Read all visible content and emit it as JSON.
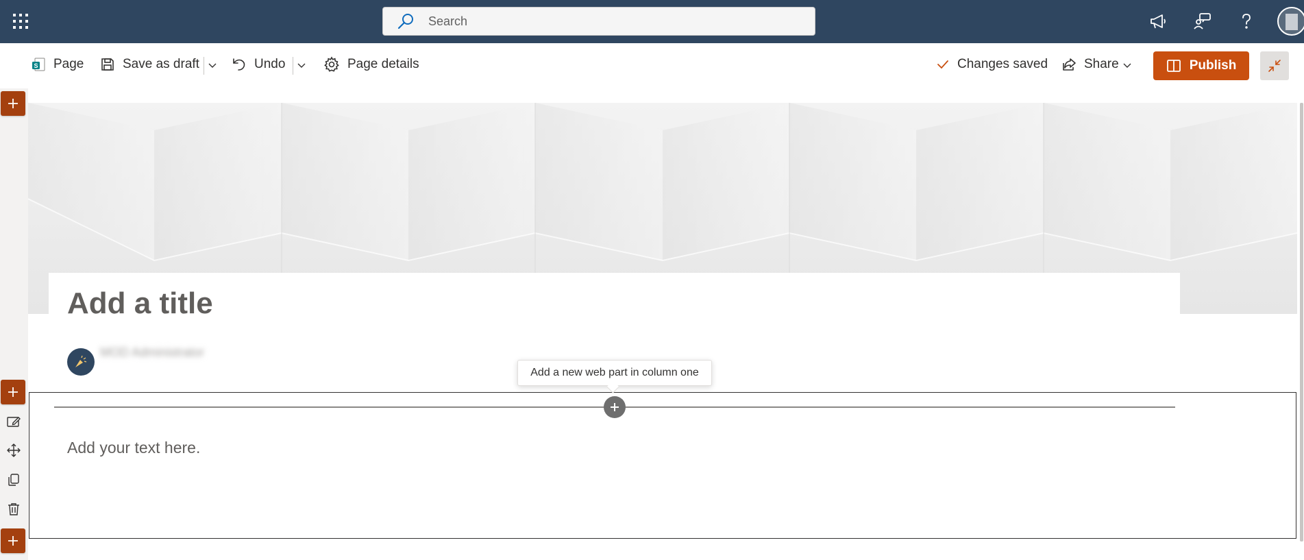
{
  "suite_bar": {
    "search_placeholder": "Search",
    "icons": [
      "app-launcher-icon",
      "search-icon",
      "megaphone-icon",
      "feedback-icon",
      "help-icon",
      "account-avatar"
    ],
    "background": "#2f4660"
  },
  "command_bar": {
    "page_label": "Page",
    "save_label": "Save as draft",
    "undo_label": "Undo",
    "details_label": "Page details",
    "status_label": "Changes saved",
    "share_label": "Share",
    "publish_label": "Publish",
    "publish_color": "#c94f0f"
  },
  "canvas": {
    "title_placeholder": "Add a title",
    "author_name": "MOD Administrator",
    "tooltip": "Add a new web part in column one",
    "text_placeholder": "Add your text here."
  },
  "left_rail": {
    "accent": "#a4400f",
    "tools": [
      "edit-section-icon",
      "move-section-icon",
      "duplicate-section-icon",
      "delete-section-icon"
    ]
  }
}
